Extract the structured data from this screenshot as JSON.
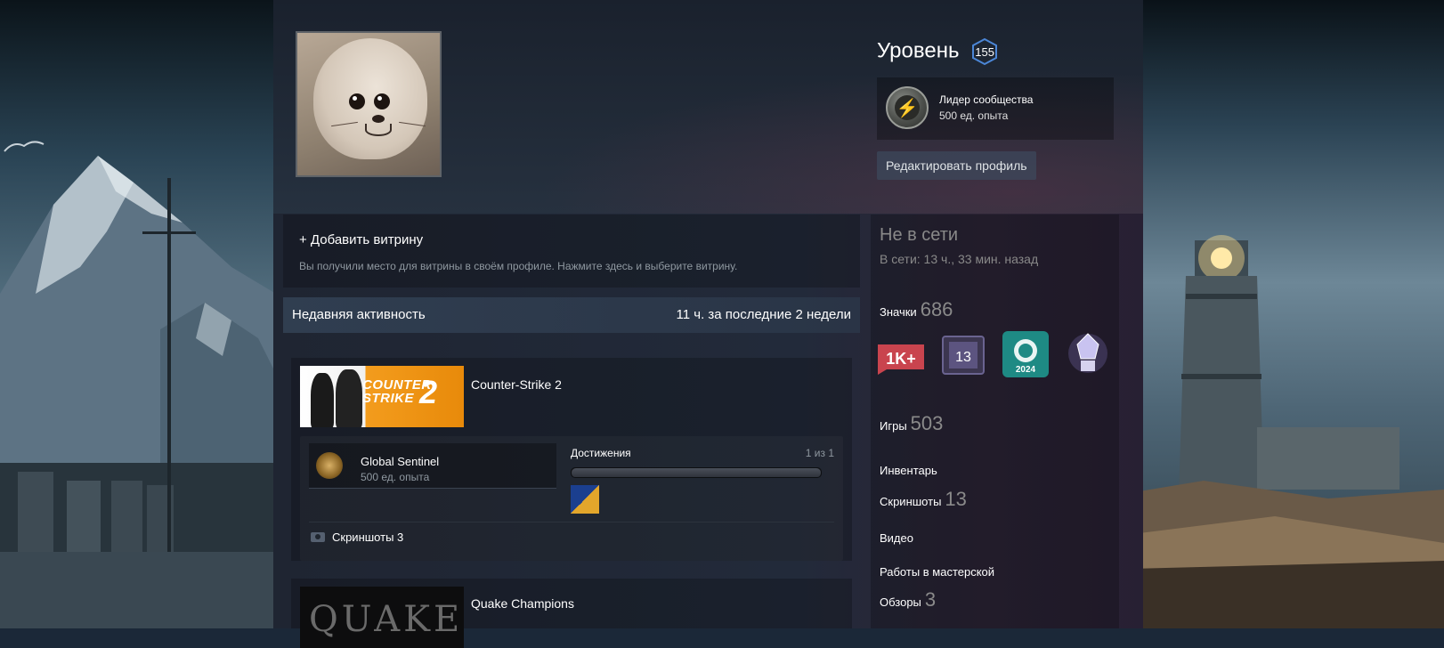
{
  "profile": {
    "level_label": "Уровень",
    "level_value": "155",
    "featured_badge": {
      "name": "Лидер сообщества",
      "xp": "500 ед. опыта",
      "icon": "lightning-badge-icon"
    },
    "edit_button": "Редактировать профиль"
  },
  "showcase": {
    "title": "+ Добавить витрину",
    "description": "Вы получили место для витрины в своём профиле. Нажмите здесь и выберите витрину."
  },
  "recent_activity": {
    "title": "Недавняя активность",
    "hours": "11 ч. за последние 2 недели",
    "games": [
      {
        "name": "Counter-Strike 2",
        "capsule_text_1": "COUNTER",
        "capsule_text_2": "STRIKE",
        "capsule_text_3": "2",
        "badge_name": "Global Sentinel",
        "badge_xp": "500 ед. опыта",
        "achievements_label": "Достижения",
        "achievements_count": "1 из 1",
        "achievements_progress": 1.0,
        "screenshots": "Скриншоты 3"
      },
      {
        "name": "Quake Champions",
        "capsule_text": "QUAKE"
      }
    ]
  },
  "sidebar": {
    "status": "Не в сети",
    "last_online": "В сети: 13 ч., 33 мин. назад",
    "badges_label": "Значки",
    "badges_count": "686",
    "badge_icons": [
      "1k-badge-icon",
      "years-13-badge-icon",
      "steam-2024-badge-icon",
      "crystal-badge-icon"
    ],
    "badge_texts": [
      "1K+",
      "13",
      "2024"
    ],
    "games_label": "Игры",
    "games_count": "503",
    "inventory_label": "Инвентарь",
    "screenshots_label": "Скриншоты",
    "screenshots_count": "13",
    "video_label": "Видео",
    "workshop_label": "Работы в мастерской",
    "reviews_label": "Обзоры",
    "reviews_count": "3"
  },
  "colors": {
    "level_badge_border": "#4b86d6",
    "cs_orange": "#f39c1d",
    "status_gray": "#898989"
  }
}
